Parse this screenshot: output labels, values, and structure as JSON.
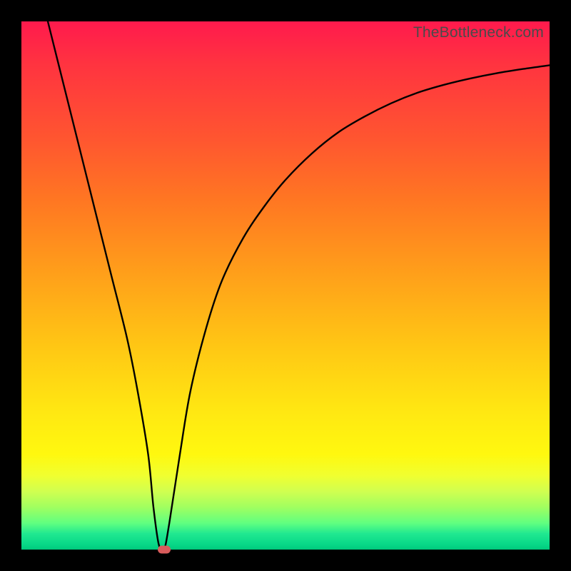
{
  "watermark": "TheBottleneck.com",
  "chart_data": {
    "type": "line",
    "title": "",
    "xlabel": "",
    "ylabel": "",
    "xlim": [
      0,
      100
    ],
    "ylim": [
      0,
      100
    ],
    "series": [
      {
        "name": "curve",
        "x": [
          5,
          8,
          11,
          14,
          17,
          20,
          22,
          24,
          25,
          26,
          27,
          28,
          30,
          32,
          35,
          38,
          42,
          46,
          50,
          55,
          60,
          65,
          70,
          75,
          80,
          85,
          90,
          95,
          100
        ],
        "y": [
          100,
          88,
          76,
          64,
          52,
          40,
          30,
          18,
          8,
          1,
          0,
          5,
          18,
          30,
          42,
          51,
          59,
          65,
          70,
          75,
          79,
          82,
          84.5,
          86.5,
          88,
          89.2,
          90.2,
          91,
          91.7
        ]
      }
    ],
    "marker": {
      "x": 27,
      "y": 0
    },
    "gradient_stops": [
      {
        "pos": 0,
        "color": "#ff1a4d"
      },
      {
        "pos": 50,
        "color": "#ffb018"
      },
      {
        "pos": 80,
        "color": "#fff80f"
      },
      {
        "pos": 100,
        "color": "#00c87c"
      }
    ]
  }
}
